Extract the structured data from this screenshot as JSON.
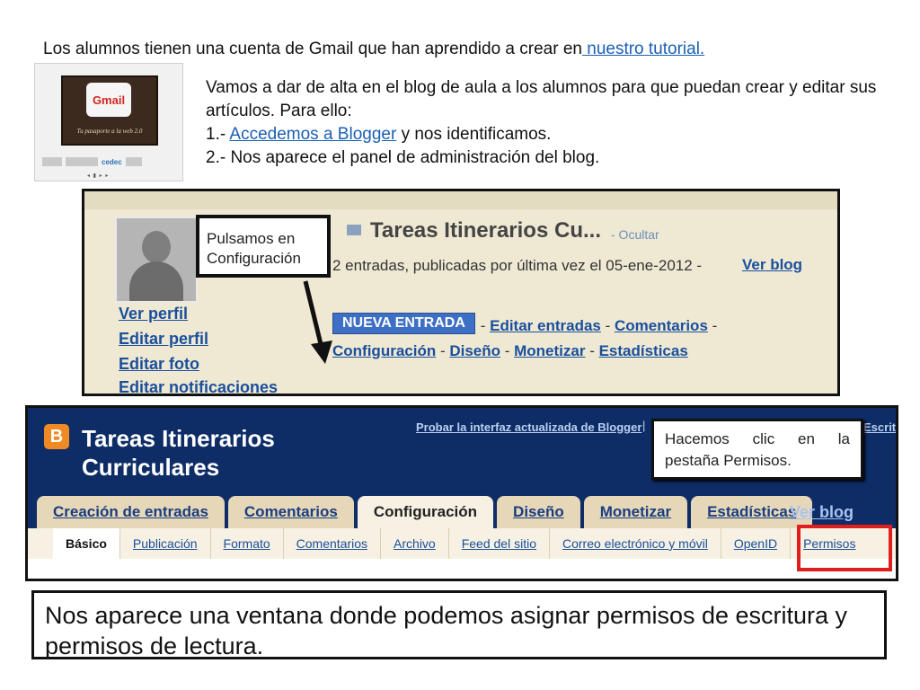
{
  "intro": {
    "text": "Los alumnos tienen una cuenta de Gmail que han aprendido a crear en",
    "link": " nuestro tutorial."
  },
  "thumbnail": {
    "logo": "Gmail",
    "caption": "Tu pasaporte a la web 2.0",
    "cedec": "cedec",
    "controls": "◂ ▮ ▸ ▸"
  },
  "steps": {
    "line1": "Vamos a dar de alta en el blog de aula a los alumnos para que puedan crear y editar sus artículos. Para ello:",
    "step1_prefix": "1.- ",
    "step1_link": "Accedemos a Blogger",
    "step1_suffix": " y nos identificamos.",
    "step2": "2.- Nos aparece el panel de administración del blog."
  },
  "dashboard": {
    "blog_title": "Tareas Itinerarios Cu...",
    "hide": "- Ocultar",
    "entries_text": "2 entradas, publicadas por última vez el 05-ene-2012 -",
    "view_blog": "Ver blog",
    "new_entry": "NUEVA ENTRADA",
    "edit_entries": "Editar entradas",
    "comments": "Comentarios",
    "settings": "Configuración",
    "design": "Diseño",
    "monetize": "Monetizar",
    "stats": "Estadísticas",
    "profile_links": [
      "Ver perfil",
      "Editar perfil",
      "Editar foto",
      "Editar notificaciones"
    ],
    "callout": "Pulsamos en Configuración"
  },
  "settings_screen": {
    "blog_title": "Tareas Itinerarios Curriculares",
    "try_new": "Probar la interfaz actualizada de Blogger",
    "try_sep": "|",
    "escrit": "Escrit",
    "tabs": [
      "Creación de entradas",
      "Comentarios",
      "Configuración",
      "Diseño",
      "Monetizar",
      "Estadísticas"
    ],
    "active_tab": 2,
    "view_blog": "Ver blog",
    "subtabs": [
      "Básico",
      "Publicación",
      "Formato",
      "Comentarios",
      "Archivo",
      "Feed del sitio",
      "Correo electrónico y móvil",
      "OpenID",
      "Permisos"
    ],
    "active_subtab": 0,
    "callout": "Hacemos clic en la pestaña Permisos.",
    "highlight_color": "#e01e1e"
  },
  "note": "Nos aparece una ventana donde podemos asignar permisos de escritura y permisos de lectura."
}
